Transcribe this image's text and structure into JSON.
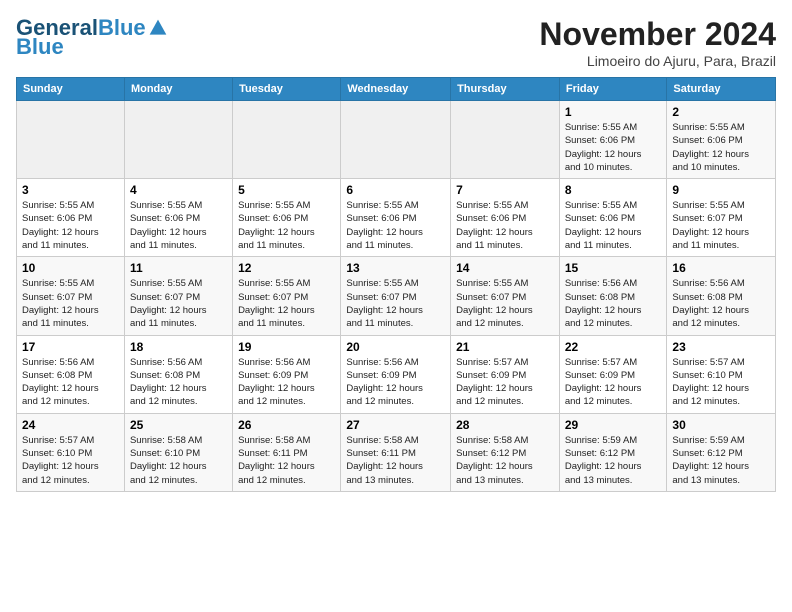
{
  "header": {
    "logo_line1": "General",
    "logo_line2": "Blue",
    "month": "November 2024",
    "location": "Limoeiro do Ajuru, Para, Brazil"
  },
  "weekdays": [
    "Sunday",
    "Monday",
    "Tuesday",
    "Wednesday",
    "Thursday",
    "Friday",
    "Saturday"
  ],
  "weeks": [
    [
      {
        "day": "",
        "info": ""
      },
      {
        "day": "",
        "info": ""
      },
      {
        "day": "",
        "info": ""
      },
      {
        "day": "",
        "info": ""
      },
      {
        "day": "",
        "info": ""
      },
      {
        "day": "1",
        "info": "Sunrise: 5:55 AM\nSunset: 6:06 PM\nDaylight: 12 hours\nand 10 minutes."
      },
      {
        "day": "2",
        "info": "Sunrise: 5:55 AM\nSunset: 6:06 PM\nDaylight: 12 hours\nand 10 minutes."
      }
    ],
    [
      {
        "day": "3",
        "info": "Sunrise: 5:55 AM\nSunset: 6:06 PM\nDaylight: 12 hours\nand 11 minutes."
      },
      {
        "day": "4",
        "info": "Sunrise: 5:55 AM\nSunset: 6:06 PM\nDaylight: 12 hours\nand 11 minutes."
      },
      {
        "day": "5",
        "info": "Sunrise: 5:55 AM\nSunset: 6:06 PM\nDaylight: 12 hours\nand 11 minutes."
      },
      {
        "day": "6",
        "info": "Sunrise: 5:55 AM\nSunset: 6:06 PM\nDaylight: 12 hours\nand 11 minutes."
      },
      {
        "day": "7",
        "info": "Sunrise: 5:55 AM\nSunset: 6:06 PM\nDaylight: 12 hours\nand 11 minutes."
      },
      {
        "day": "8",
        "info": "Sunrise: 5:55 AM\nSunset: 6:06 PM\nDaylight: 12 hours\nand 11 minutes."
      },
      {
        "day": "9",
        "info": "Sunrise: 5:55 AM\nSunset: 6:07 PM\nDaylight: 12 hours\nand 11 minutes."
      }
    ],
    [
      {
        "day": "10",
        "info": "Sunrise: 5:55 AM\nSunset: 6:07 PM\nDaylight: 12 hours\nand 11 minutes."
      },
      {
        "day": "11",
        "info": "Sunrise: 5:55 AM\nSunset: 6:07 PM\nDaylight: 12 hours\nand 11 minutes."
      },
      {
        "day": "12",
        "info": "Sunrise: 5:55 AM\nSunset: 6:07 PM\nDaylight: 12 hours\nand 11 minutes."
      },
      {
        "day": "13",
        "info": "Sunrise: 5:55 AM\nSunset: 6:07 PM\nDaylight: 12 hours\nand 11 minutes."
      },
      {
        "day": "14",
        "info": "Sunrise: 5:55 AM\nSunset: 6:07 PM\nDaylight: 12 hours\nand 12 minutes."
      },
      {
        "day": "15",
        "info": "Sunrise: 5:56 AM\nSunset: 6:08 PM\nDaylight: 12 hours\nand 12 minutes."
      },
      {
        "day": "16",
        "info": "Sunrise: 5:56 AM\nSunset: 6:08 PM\nDaylight: 12 hours\nand 12 minutes."
      }
    ],
    [
      {
        "day": "17",
        "info": "Sunrise: 5:56 AM\nSunset: 6:08 PM\nDaylight: 12 hours\nand 12 minutes."
      },
      {
        "day": "18",
        "info": "Sunrise: 5:56 AM\nSunset: 6:08 PM\nDaylight: 12 hours\nand 12 minutes."
      },
      {
        "day": "19",
        "info": "Sunrise: 5:56 AM\nSunset: 6:09 PM\nDaylight: 12 hours\nand 12 minutes."
      },
      {
        "day": "20",
        "info": "Sunrise: 5:56 AM\nSunset: 6:09 PM\nDaylight: 12 hours\nand 12 minutes."
      },
      {
        "day": "21",
        "info": "Sunrise: 5:57 AM\nSunset: 6:09 PM\nDaylight: 12 hours\nand 12 minutes."
      },
      {
        "day": "22",
        "info": "Sunrise: 5:57 AM\nSunset: 6:09 PM\nDaylight: 12 hours\nand 12 minutes."
      },
      {
        "day": "23",
        "info": "Sunrise: 5:57 AM\nSunset: 6:10 PM\nDaylight: 12 hours\nand 12 minutes."
      }
    ],
    [
      {
        "day": "24",
        "info": "Sunrise: 5:57 AM\nSunset: 6:10 PM\nDaylight: 12 hours\nand 12 minutes."
      },
      {
        "day": "25",
        "info": "Sunrise: 5:58 AM\nSunset: 6:10 PM\nDaylight: 12 hours\nand 12 minutes."
      },
      {
        "day": "26",
        "info": "Sunrise: 5:58 AM\nSunset: 6:11 PM\nDaylight: 12 hours\nand 12 minutes."
      },
      {
        "day": "27",
        "info": "Sunrise: 5:58 AM\nSunset: 6:11 PM\nDaylight: 12 hours\nand 13 minutes."
      },
      {
        "day": "28",
        "info": "Sunrise: 5:58 AM\nSunset: 6:12 PM\nDaylight: 12 hours\nand 13 minutes."
      },
      {
        "day": "29",
        "info": "Sunrise: 5:59 AM\nSunset: 6:12 PM\nDaylight: 12 hours\nand 13 minutes."
      },
      {
        "day": "30",
        "info": "Sunrise: 5:59 AM\nSunset: 6:12 PM\nDaylight: 12 hours\nand 13 minutes."
      }
    ]
  ]
}
